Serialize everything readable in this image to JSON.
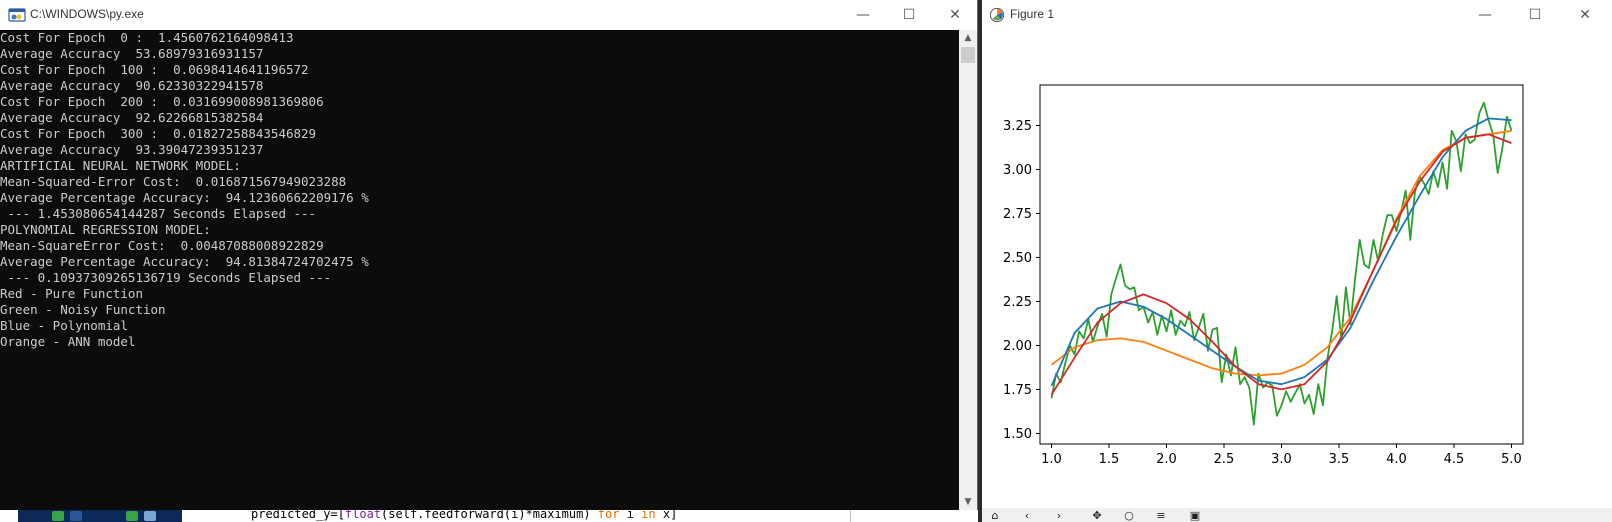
{
  "console_window": {
    "title": "C:\\WINDOWS\\py.exe",
    "lines": [
      "Cost For Epoch  0 :  1.4560762164098413",
      "Average Accuracy  53.68979316931157",
      "Cost For Epoch  100 :  0.0698414641196572",
      "Average Accuracy  90.62330322941578",
      "Cost For Epoch  200 :  0.031699008981369806",
      "Average Accuracy  92.62266815382584",
      "Cost For Epoch  300 :  0.01827258843546829",
      "Average Accuracy  93.39047239351237",
      "ARTIFICIAL NEURAL NETWORK MODEL:",
      "Mean-Squared-Error Cost:  0.016871567949023288",
      "Average Percentage Accuracy:  94.12360662209176 %",
      " --- 1.453080654144287 Seconds Elapsed ---",
      "POLYNOMIAL REGRESSION MODEL:",
      "Mean-SquareError Cost:  0.00487088008922829",
      "Average Percentage Accuracy:  94.81384724702475 %",
      " --- 0.10937309265136719 Seconds Elapsed ---",
      "Red - Pure Function",
      "Green - Noisy Function",
      "Blue - Polynomial",
      "Orange - ANN model"
    ]
  },
  "editor_snippet": {
    "prefix": "predicted_y=[",
    "func": "float",
    "middle": "(self.feedforward(i)*maximum) ",
    "kw_for": "for",
    "var_i": " i ",
    "kw_in": "in",
    "suffix": " x]"
  },
  "figure_window": {
    "title": "Figure 1"
  },
  "window_controls": {
    "minimize": "—",
    "maximize": "☐",
    "close": "✕"
  },
  "colors": {
    "blue": "#1f77b4",
    "orange": "#ff7f0e",
    "green": "#2ca02c",
    "red": "#d62728"
  },
  "chart_data": {
    "type": "line",
    "xlim": [
      0.9,
      5.1
    ],
    "ylim": [
      1.44,
      3.48
    ],
    "xticks": [
      1.0,
      1.5,
      2.0,
      2.5,
      3.0,
      3.5,
      4.0,
      4.5,
      5.0
    ],
    "xtick_labels": [
      "1.0",
      "1.5",
      "2.0",
      "2.5",
      "3.0",
      "3.5",
      "4.0",
      "4.5",
      "5.0"
    ],
    "yticks": [
      1.5,
      1.75,
      2.0,
      2.25,
      2.5,
      2.75,
      3.0,
      3.25
    ],
    "ytick_labels": [
      "1.50",
      "1.75",
      "2.00",
      "2.25",
      "2.50",
      "2.75",
      "3.00",
      "3.25"
    ],
    "grid": false,
    "series": [
      {
        "color": "green",
        "x": [
          1.0,
          1.04,
          1.08,
          1.12,
          1.16,
          1.2,
          1.24,
          1.28,
          1.32,
          1.36,
          1.4,
          1.44,
          1.48,
          1.52,
          1.56,
          1.6,
          1.64,
          1.68,
          1.72,
          1.76,
          1.8,
          1.84,
          1.88,
          1.92,
          1.96,
          2.0,
          2.04,
          2.08,
          2.12,
          2.16,
          2.2,
          2.24,
          2.28,
          2.32,
          2.36,
          2.4,
          2.44,
          2.48,
          2.52,
          2.56,
          2.6,
          2.64,
          2.68,
          2.72,
          2.76,
          2.8,
          2.84,
          2.88,
          2.92,
          2.96,
          3.0,
          3.04,
          3.08,
          3.12,
          3.16,
          3.2,
          3.24,
          3.28,
          3.32,
          3.36,
          3.4,
          3.44,
          3.48,
          3.52,
          3.56,
          3.6,
          3.64,
          3.68,
          3.72,
          3.76,
          3.8,
          3.84,
          3.88,
          3.92,
          3.96,
          4.0,
          4.04,
          4.08,
          4.12,
          4.16,
          4.2,
          4.24,
          4.28,
          4.32,
          4.36,
          4.4,
          4.44,
          4.48,
          4.52,
          4.56,
          4.6,
          4.64,
          4.68,
          4.72,
          4.76,
          4.8,
          4.84,
          4.88,
          4.92,
          4.96,
          5.0
        ],
        "values": [
          1.7,
          1.84,
          1.79,
          1.9,
          2.0,
          1.95,
          2.08,
          2.04,
          2.15,
          2.02,
          2.11,
          2.18,
          2.05,
          2.29,
          2.38,
          2.46,
          2.34,
          2.32,
          2.33,
          2.2,
          2.22,
          2.13,
          2.19,
          2.06,
          2.17,
          2.08,
          2.2,
          2.06,
          2.14,
          2.11,
          2.19,
          2.03,
          2.1,
          2.18,
          1.97,
          2.09,
          2.1,
          1.79,
          1.95,
          1.83,
          1.99,
          1.78,
          1.82,
          1.76,
          1.55,
          1.84,
          1.76,
          1.79,
          1.77,
          1.6,
          1.66,
          1.74,
          1.68,
          1.73,
          1.78,
          1.67,
          1.72,
          1.61,
          1.78,
          1.66,
          1.93,
          2.08,
          2.28,
          2.04,
          2.33,
          2.12,
          2.38,
          2.6,
          2.46,
          2.44,
          2.6,
          2.48,
          2.63,
          2.74,
          2.74,
          2.65,
          2.76,
          2.88,
          2.6,
          2.87,
          2.96,
          2.92,
          2.86,
          2.99,
          2.9,
          3.04,
          2.89,
          3.22,
          3.16,
          2.99,
          3.2,
          3.15,
          3.17,
          3.32,
          3.38,
          3.28,
          3.2,
          2.98,
          3.12,
          3.3,
          3.22
        ]
      },
      {
        "color": "orange",
        "x": [
          1.0,
          1.2,
          1.4,
          1.6,
          1.8,
          2.0,
          2.2,
          2.4,
          2.6,
          2.8,
          3.0,
          3.2,
          3.4,
          3.6,
          3.8,
          4.0,
          4.2,
          4.4,
          4.6,
          4.8,
          5.0
        ],
        "values": [
          1.89,
          1.99,
          2.03,
          2.04,
          2.02,
          1.97,
          1.92,
          1.87,
          1.84,
          1.83,
          1.84,
          1.89,
          1.99,
          2.16,
          2.43,
          2.72,
          2.96,
          3.11,
          3.18,
          3.2,
          3.22
        ]
      },
      {
        "color": "blue",
        "x": [
          1.0,
          1.2,
          1.4,
          1.6,
          1.8,
          2.0,
          2.2,
          2.4,
          2.6,
          2.8,
          3.0,
          3.2,
          3.4,
          3.6,
          3.8,
          4.0,
          4.2,
          4.4,
          4.6,
          4.8,
          5.0
        ],
        "values": [
          1.77,
          2.07,
          2.21,
          2.25,
          2.22,
          2.15,
          2.06,
          1.97,
          1.88,
          1.8,
          1.78,
          1.82,
          1.92,
          2.1,
          2.37,
          2.62,
          2.85,
          3.07,
          3.22,
          3.29,
          3.28
        ]
      },
      {
        "color": "red",
        "x": [
          1.0,
          1.2,
          1.4,
          1.6,
          1.8,
          2.0,
          2.2,
          2.4,
          2.6,
          2.8,
          3.0,
          3.2,
          3.4,
          3.6,
          3.8,
          4.0,
          4.2,
          4.4,
          4.6,
          4.8,
          5.0
        ],
        "values": [
          1.72,
          1.93,
          2.13,
          2.24,
          2.29,
          2.24,
          2.15,
          2.02,
          1.88,
          1.78,
          1.75,
          1.78,
          1.91,
          2.14,
          2.43,
          2.71,
          2.93,
          3.1,
          3.18,
          3.2,
          3.15
        ]
      }
    ]
  }
}
